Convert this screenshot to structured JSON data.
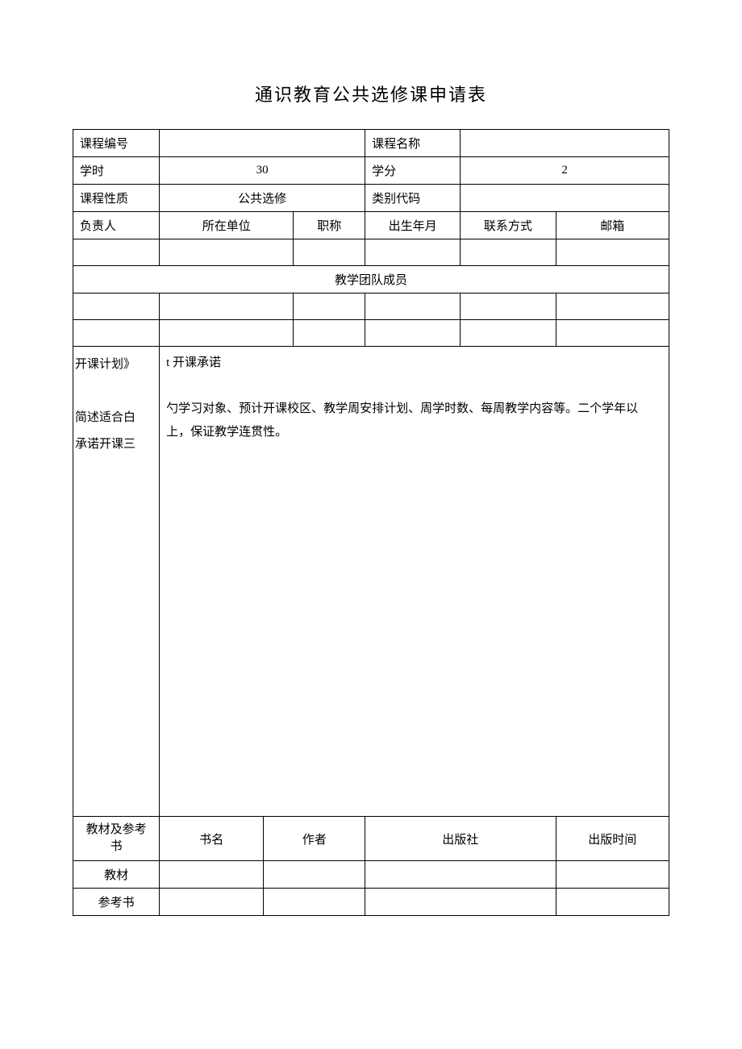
{
  "title": "通识教育公共选修课申请表",
  "labels": {
    "course_code": "课程编号",
    "course_name": "课程名称",
    "hours": "学时",
    "credits": "学分",
    "course_nature": "课程性质",
    "category_code": "类别代码",
    "leader": "负责人",
    "unit": "所在单位",
    "title_rank": "职称",
    "birth": "出生年月",
    "contact": "联系方式",
    "email": "邮箱",
    "team_members": "教学团队成员",
    "plan_left": "开课计划》\n\n简述适合白\n承诺开课三",
    "plan_body": "t 开课承诺\n\n勺学习对象、预计开课校区、教学周安排计划、周学时数、每周教学内容等。二个学年以上，保证教学连贯性。",
    "textbooks": "教材及参考\n书",
    "book_name": "书名",
    "author": "作者",
    "publisher": "出版社",
    "pub_time": "出版时间",
    "textbook_row": "教材",
    "reference_row": "参考书"
  },
  "values": {
    "course_code": "",
    "course_name": "",
    "hours": "30",
    "credits": "2",
    "course_nature": "公共选修",
    "category_code": "",
    "leader": "",
    "unit": "",
    "title_rank": "",
    "birth": "",
    "contact": "",
    "email": "",
    "team": [
      [
        "",
        "",
        "",
        "",
        "",
        ""
      ],
      [
        "",
        "",
        "",
        "",
        "",
        ""
      ]
    ],
    "textbooks": {
      "textbook": {
        "name": "",
        "author": "",
        "publisher": "",
        "pub_time": ""
      },
      "reference": {
        "name": "",
        "author": "",
        "publisher": "",
        "pub_time": ""
      }
    }
  }
}
